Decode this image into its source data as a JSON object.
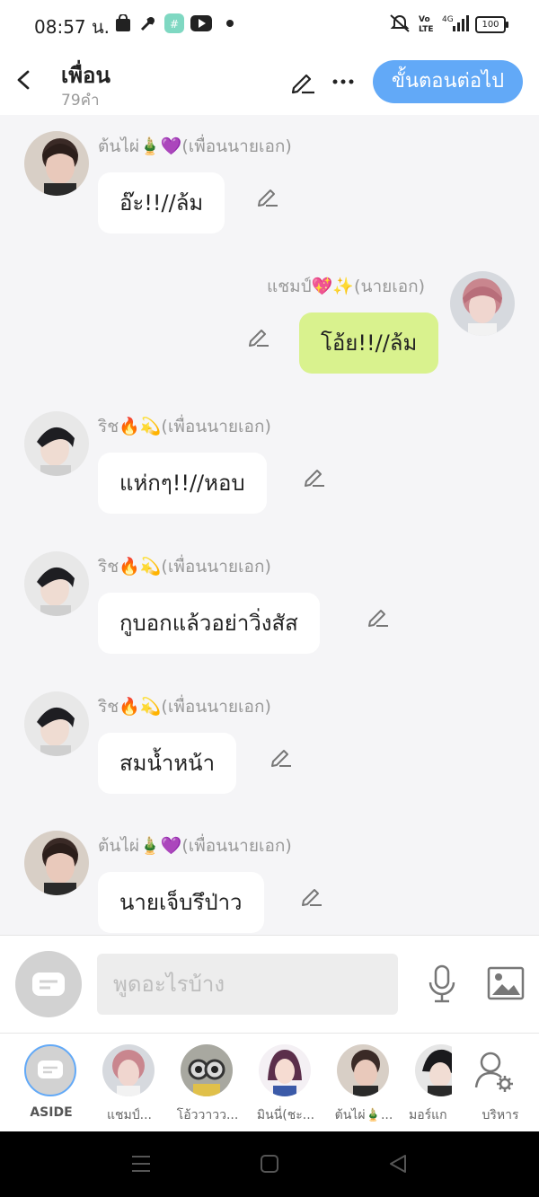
{
  "status_bar": {
    "time": "08:57 น.",
    "battery": "100",
    "network": "4G"
  },
  "header": {
    "title": "เพื่อน",
    "word_count": "79คำ",
    "next_label": "ขั้นตอนต่อไป"
  },
  "messages": [
    {
      "sender": "ต้นไผ่🎍💜(เพื่อนนายเอก)",
      "text": "อ๊ะ!!//ล้ม",
      "side": "left"
    },
    {
      "sender": "แชมป์💖✨(นายเอก)",
      "text": "โอ้ย!!//ล้ม",
      "side": "right"
    },
    {
      "sender": "ริช🔥💫(เพื่อนนายเอก)",
      "text": "แห่กๆ!!//หอบ",
      "side": "left"
    },
    {
      "sender": "ริช🔥💫(เพื่อนนายเอก)",
      "text": "กูบอกแล้วอย่าวิ่งสัส",
      "side": "left"
    },
    {
      "sender": "ริช🔥💫(เพื่อนนายเอก)",
      "text": "สมน้ำหน้า",
      "side": "left"
    },
    {
      "sender": "ต้นไผ่🎍💜(เพื่อนนายเอก)",
      "text": "นายเจ็บรึป่าว",
      "side": "left"
    }
  ],
  "input": {
    "placeholder": "พูดอะไรบ้าง"
  },
  "characters": [
    {
      "label": "ASIDE"
    },
    {
      "label": "แชมป์..."
    },
    {
      "label": "โอ้ววาวว..."
    },
    {
      "label": "มินนี่(ชะ..."
    },
    {
      "label": "ต้นไผ่🎍..."
    },
    {
      "label": "มอร์แก"
    },
    {
      "label": "บริหาร"
    }
  ],
  "colors": {
    "accent": "#62a9f7",
    "my_bubble": "#d9f28e",
    "other_bubble": "#ffffff"
  }
}
